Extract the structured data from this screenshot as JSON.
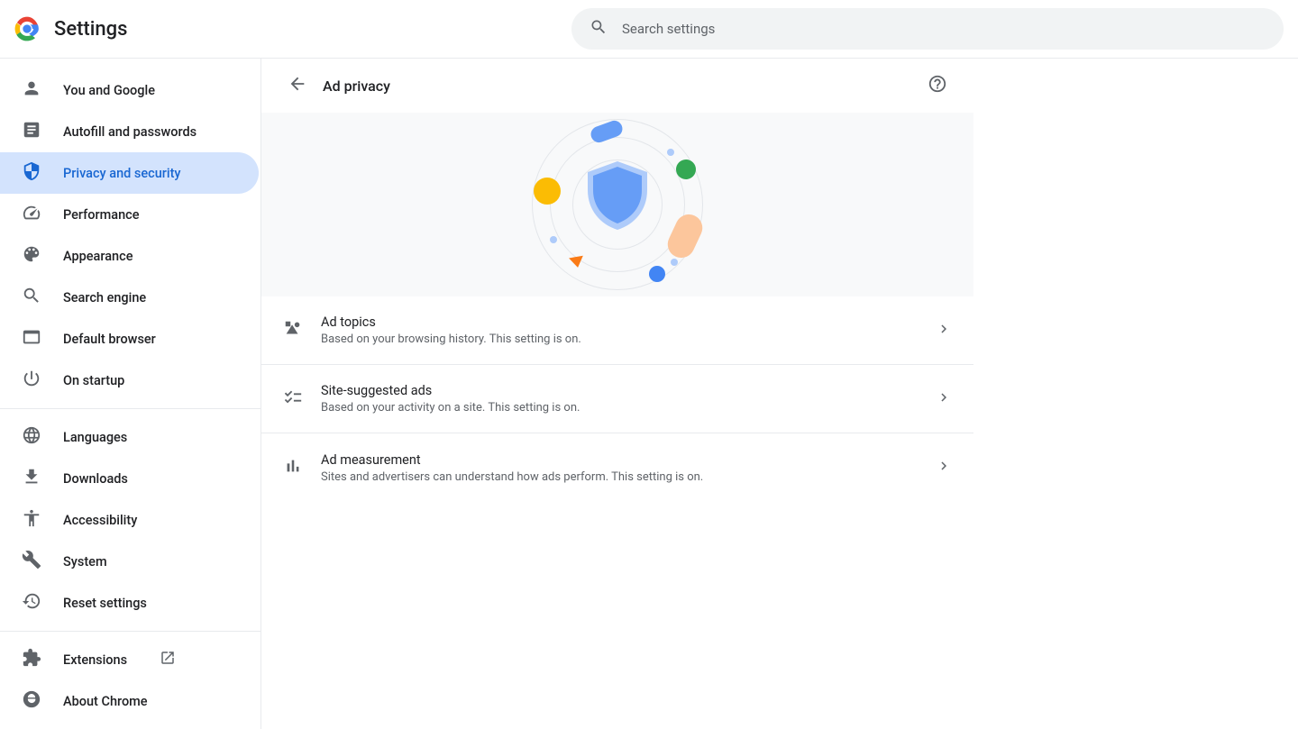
{
  "header": {
    "title": "Settings",
    "search_placeholder": "Search settings"
  },
  "sidebar": {
    "items": [
      {
        "id": "you-and-google",
        "label": "You and Google",
        "icon": "person"
      },
      {
        "id": "autofill",
        "label": "Autofill and passwords",
        "icon": "autofill"
      },
      {
        "id": "privacy",
        "label": "Privacy and security",
        "icon": "shield",
        "active": true
      },
      {
        "id": "performance",
        "label": "Performance",
        "icon": "speedometer"
      },
      {
        "id": "appearance",
        "label": "Appearance",
        "icon": "palette"
      },
      {
        "id": "search-engine",
        "label": "Search engine",
        "icon": "search"
      },
      {
        "id": "default-browser",
        "label": "Default browser",
        "icon": "browser"
      },
      {
        "id": "on-startup",
        "label": "On startup",
        "icon": "power"
      }
    ],
    "items2": [
      {
        "id": "languages",
        "label": "Languages",
        "icon": "globe"
      },
      {
        "id": "downloads",
        "label": "Downloads",
        "icon": "download"
      },
      {
        "id": "accessibility",
        "label": "Accessibility",
        "icon": "accessibility"
      },
      {
        "id": "system",
        "label": "System",
        "icon": "wrench"
      },
      {
        "id": "reset",
        "label": "Reset settings",
        "icon": "restore"
      }
    ],
    "items3": [
      {
        "id": "extensions",
        "label": "Extensions",
        "icon": "extension",
        "external": true
      },
      {
        "id": "about",
        "label": "About Chrome",
        "icon": "chrome"
      }
    ]
  },
  "main": {
    "title": "Ad privacy",
    "settings": [
      {
        "id": "ad-topics",
        "icon": "shapes",
        "title": "Ad topics",
        "desc": "Based on your browsing history. This setting is on."
      },
      {
        "id": "site-suggested-ads",
        "icon": "checklist",
        "title": "Site-suggested ads",
        "desc": "Based on your activity on a site. This setting is on."
      },
      {
        "id": "ad-measurement",
        "icon": "bar-chart",
        "title": "Ad measurement",
        "desc": "Sites and advertisers can understand how ads perform. This setting is on."
      }
    ]
  }
}
